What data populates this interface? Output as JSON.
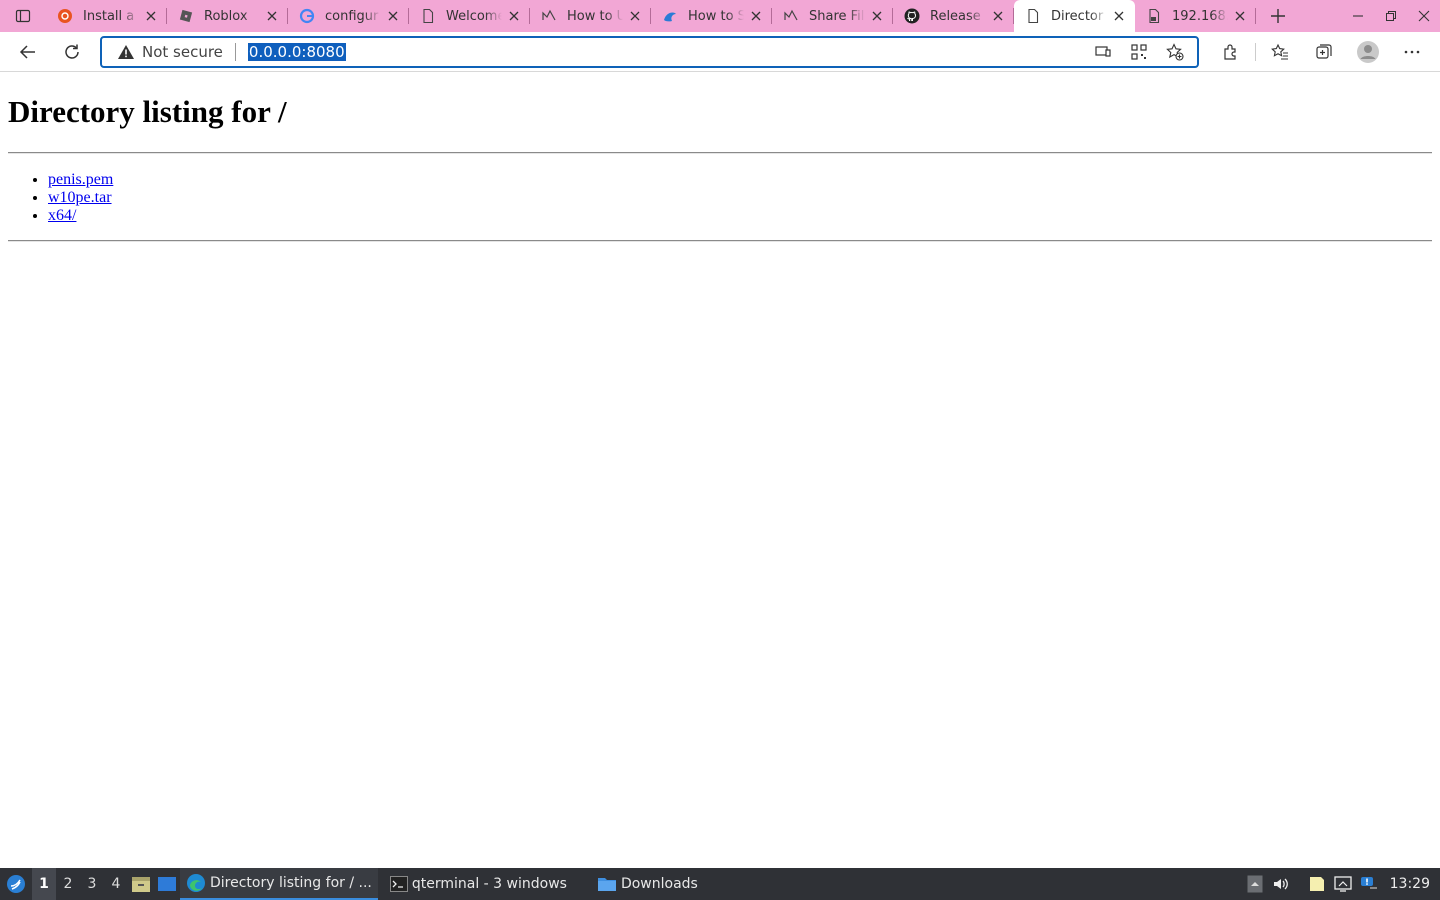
{
  "browser": {
    "tabs": [
      {
        "title": "Install a",
        "icon": "ubuntu-icon"
      },
      {
        "title": "Roblox",
        "icon": "roblox-icon"
      },
      {
        "title": "configur",
        "icon": "google-icon"
      },
      {
        "title": "Welcome",
        "icon": "page-icon"
      },
      {
        "title": "How to U",
        "icon": "pinterest-icon"
      },
      {
        "title": "How to S",
        "icon": "edge-news-icon"
      },
      {
        "title": "Share Fil",
        "icon": "pinterest-icon"
      },
      {
        "title": "Release",
        "icon": "github-icon"
      },
      {
        "title": "Director",
        "icon": "page-icon",
        "active": true
      },
      {
        "title": "192.168.",
        "icon": "lock-page-icon"
      }
    ],
    "omnibox": {
      "security_label": "Not secure",
      "url": "0.0.0.0:8080"
    }
  },
  "page": {
    "heading": "Directory listing for /",
    "entries": [
      "penis.pem",
      "w10pe.tar",
      "x64/"
    ]
  },
  "taskbar": {
    "workspaces": [
      "1",
      "2",
      "3",
      "4"
    ],
    "tasks": [
      {
        "label": "Directory listing for / ...",
        "icon": "edge-icon",
        "active": true
      },
      {
        "label": "qterminal - 3 windows",
        "icon": "terminal-icon"
      },
      {
        "label": "Downloads",
        "icon": "folder-icon"
      }
    ],
    "clock": "13:29"
  },
  "colors": {
    "tabstrip_bg": "#f2a7d5",
    "omnibox_border": "#0e62b8",
    "url_highlight": "#0f5fbd",
    "link": "#0000ee",
    "taskbar_bg": "#2f3136"
  }
}
